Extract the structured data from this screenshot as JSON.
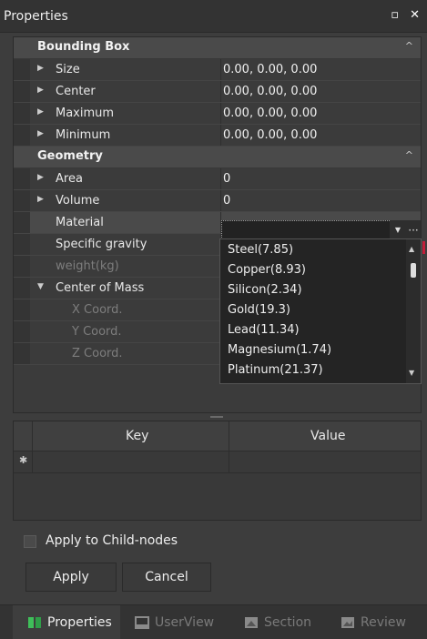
{
  "title": "Properties",
  "window_controls": {
    "restore": "▫",
    "close": "✕"
  },
  "grid": {
    "categories": [
      {
        "label": "Bounding Box",
        "chevron": "^"
      },
      {
        "label": "Geometry",
        "chevron": "^"
      }
    ],
    "bbox_rows": [
      {
        "label": "Size",
        "value": "0.00, 0.00, 0.00"
      },
      {
        "label": "Center",
        "value": "0.00, 0.00, 0.00"
      },
      {
        "label": "Maximum",
        "value": "0.00, 0.00, 0.00"
      },
      {
        "label": "Minimum",
        "value": "0.00, 0.00, 0.00"
      }
    ],
    "geometry_rows": [
      {
        "label": "Area",
        "value": "0"
      },
      {
        "label": "Volume",
        "value": "0"
      },
      {
        "label": "Material",
        "value": ""
      },
      {
        "label": "Specific gravity",
        "value": ""
      },
      {
        "label": "weight(kg)",
        "value": ""
      },
      {
        "label": "Center of Mass",
        "value": ""
      },
      {
        "label": "X Coord.",
        "value": ""
      },
      {
        "label": "Y Coord.",
        "value": ""
      },
      {
        "label": "Z Coord.",
        "value": ""
      }
    ]
  },
  "material_dropdown": {
    "options": [
      "Steel(7.85)",
      "Copper(8.93)",
      "Silicon(2.34)",
      "Gold(19.3)",
      "Lead(11.34)",
      "Magnesium(1.74)",
      "Platinum(21.37)"
    ]
  },
  "kv_table": {
    "key_header": "Key",
    "value_header": "Value"
  },
  "apply_to_children": {
    "label": "Apply to Child-nodes",
    "checked": false
  },
  "buttons": {
    "apply": "Apply",
    "cancel": "Cancel"
  },
  "tabs": [
    {
      "label": "Properties",
      "icon": "properties-icon",
      "active": true
    },
    {
      "label": "UserView",
      "icon": "userview-icon",
      "active": false
    },
    {
      "label": "Section",
      "icon": "section-icon",
      "active": false
    },
    {
      "label": "Review",
      "icon": "review-icon",
      "active": false
    }
  ],
  "colors": {
    "background": "#3d3d3d",
    "accent_mark": "#c41e3a"
  }
}
